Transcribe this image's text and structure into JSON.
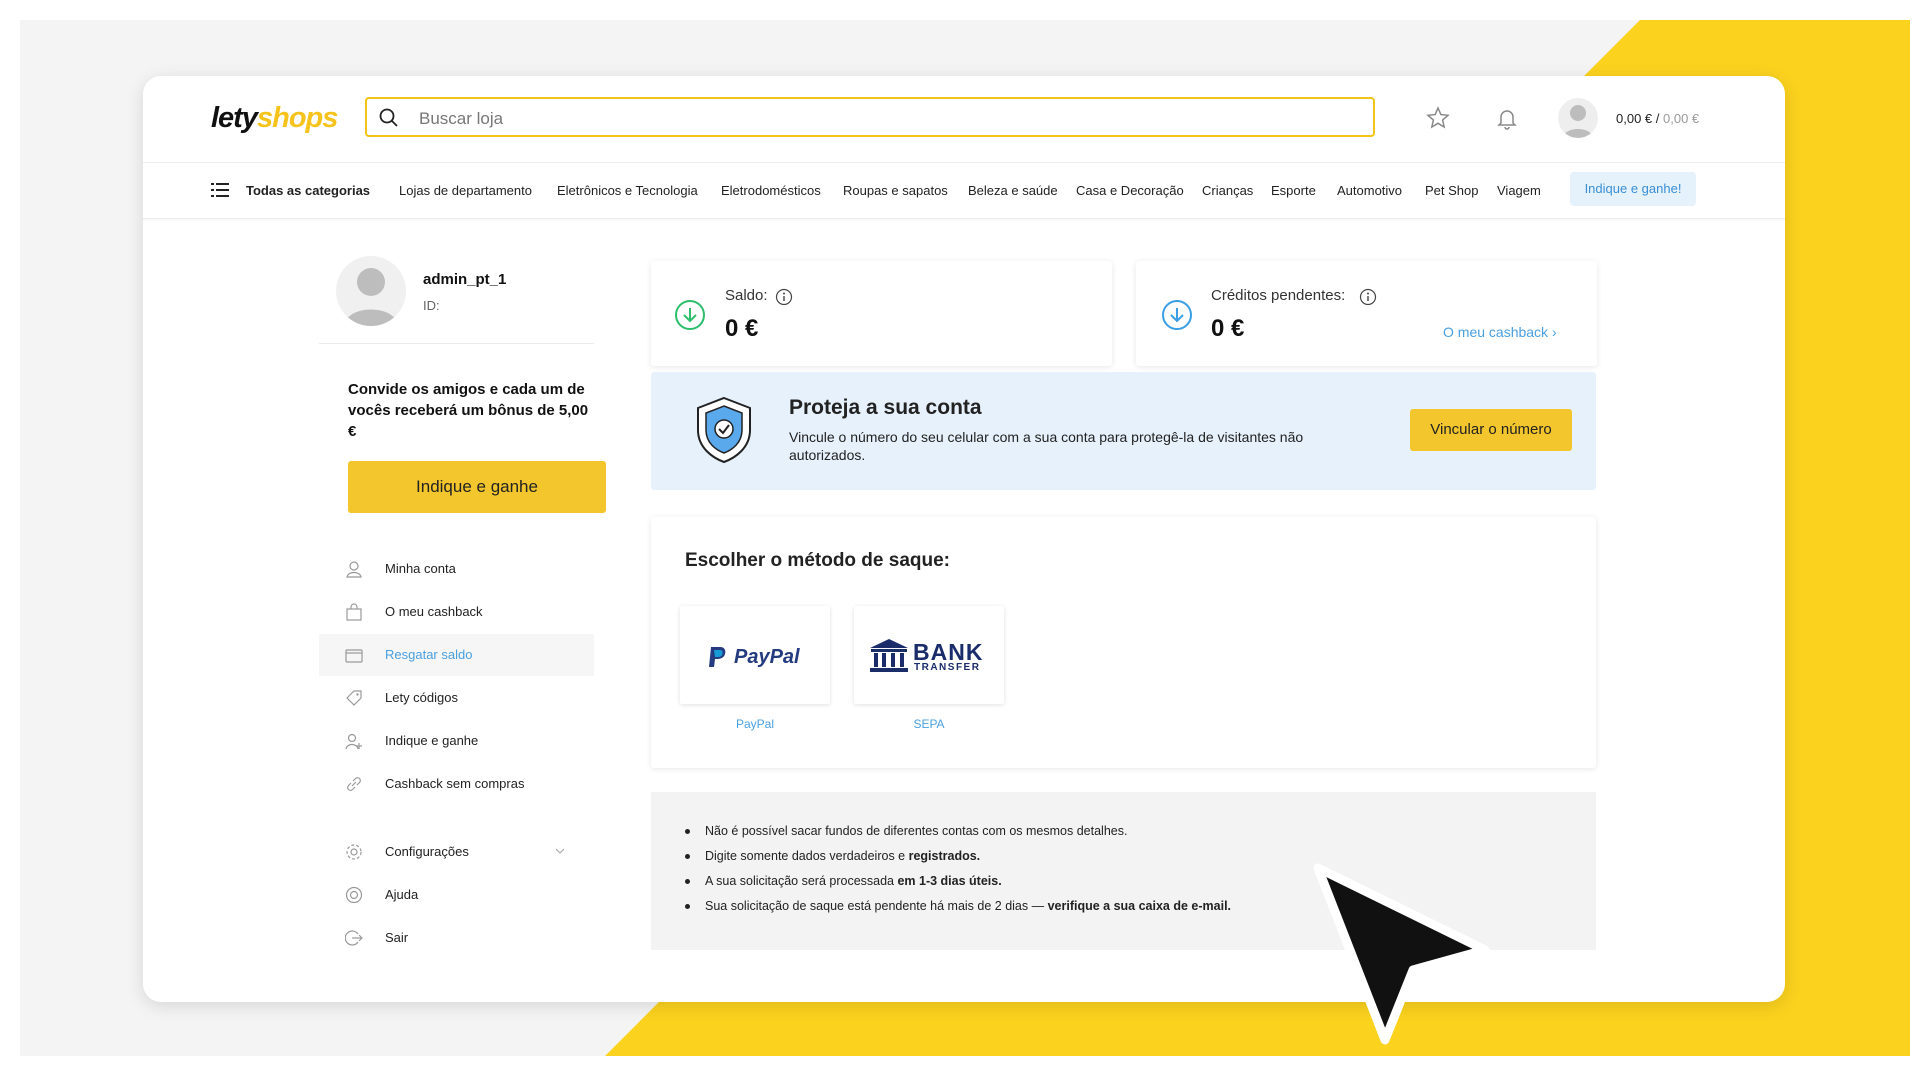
{
  "header": {
    "logo": {
      "part1": "lety",
      "part2": "shops"
    },
    "search_placeholder": "Buscar loja",
    "balance": "0,00 €",
    "separator": " / ",
    "pending": "0,00 €"
  },
  "nav": {
    "all_categories": "Todas as categorias",
    "items": [
      "Lojas de departamento",
      "Eletrônicos e Tecnologia",
      "Eletrodomésticos",
      "Roupas e sapatos",
      "Beleza e saúde",
      "Casa e Decoração",
      "Crianças",
      "Esporte",
      "Automotivo",
      "Pet Shop",
      "Viagem"
    ],
    "invite": "Indique e ganhe!"
  },
  "profile": {
    "username": "admin_pt_1",
    "id_label": "ID:"
  },
  "invite": {
    "text": "Convide os amigos e cada um de vocês receberá um bônus de 5,00 €",
    "button": "Indique e ganhe"
  },
  "menu": {
    "items": [
      "Minha conta",
      "O meu cashback",
      "Resgatar saldo",
      "Lety códigos",
      "Indique e ganhe",
      "Cashback sem compras"
    ],
    "settings": "Configurações",
    "help": "Ajuda",
    "logout": "Sair"
  },
  "balance": {
    "label": "Saldo:",
    "value": "0 €"
  },
  "pending": {
    "label": "Créditos pendentes:",
    "value": "0 €",
    "link": "O meu cashback"
  },
  "protect": {
    "title": "Proteja a sua conta",
    "text": "Vincule o número do seu celular com a sua conta para protegê-la de visitantes não autorizados.",
    "button": "Vincular o número"
  },
  "withdraw": {
    "title": "Escolher o método de saque:",
    "methods": [
      {
        "name": "PayPal",
        "logo_text": "PayPal"
      },
      {
        "name": "SEPA",
        "logo_line1": "BANK",
        "logo_line2": "TRANSFER"
      }
    ]
  },
  "notes": {
    "n1": "Não é possível sacar fundos de diferentes contas com os mesmos detalhes.",
    "n2_a": "Digite somente dados verdadeiros e ",
    "n2_b": "registrados.",
    "n3_a": "A sua solicitação será processada ",
    "n3_b": "em 1-3 dias úteis.",
    "n4_a": "Sua solicitação de saque está pendente há mais de 2 dias — ",
    "n4_b": "verifique a sua caixa de e-mail."
  },
  "colors": {
    "accent": "#f2c62c",
    "link": "#4a9fe0",
    "yellow_bg": "#fbd21e"
  }
}
